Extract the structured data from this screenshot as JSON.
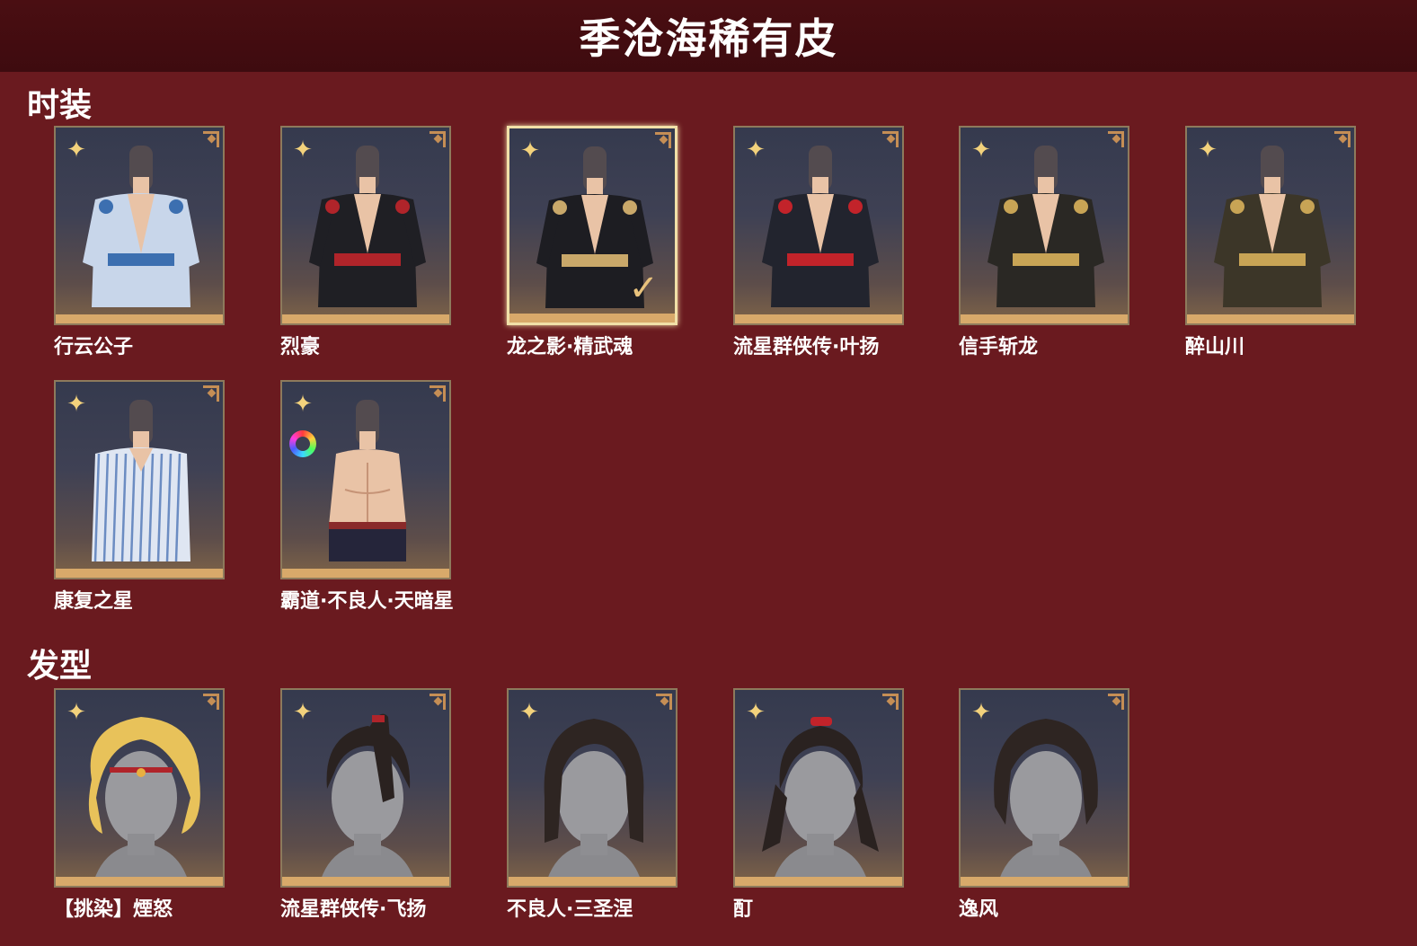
{
  "title": "季沧海稀有皮",
  "sections": [
    {
      "title": "时装",
      "items": [
        {
          "name": "行云公子",
          "selected": false,
          "outfit": "white-blue-robe"
        },
        {
          "name": "烈豪",
          "selected": false,
          "outfit": "black-red-armor"
        },
        {
          "name": "龙之影·精武魂",
          "selected": true,
          "outfit": "black-jacket"
        },
        {
          "name": "流星群侠传·叶扬",
          "selected": false,
          "outfit": "dark-armor-red-scarf"
        },
        {
          "name": "信手斩龙",
          "selected": false,
          "outfit": "dark-dragon-armor"
        },
        {
          "name": "醉山川",
          "selected": false,
          "outfit": "gold-armor"
        },
        {
          "name": "康复之星",
          "selected": false,
          "outfit": "striped-pajamas"
        },
        {
          "name": "霸道·不良人·天暗星",
          "selected": false,
          "outfit": "shirtless",
          "dye_icon": "color-palette-icon"
        }
      ]
    },
    {
      "title": "发型",
      "items": [
        {
          "name": "【挑染】煙怒",
          "hair": "blonde-spiky"
        },
        {
          "name": "流星群侠传·飞扬",
          "hair": "dark-topknot"
        },
        {
          "name": "不良人·三圣涅",
          "hair": "dark-long"
        },
        {
          "name": "酊",
          "hair": "dark-ponytail-red-tie"
        },
        {
          "name": "逸风",
          "hair": "dark-shaggy"
        }
      ]
    }
  ],
  "colors": {
    "background": "#6a1a1f",
    "header": "#3e0b0f",
    "tile_border": "#8d7a5c",
    "tile_bottom_bar": "#d8a96a",
    "star": "#f3d27c",
    "selected_border": "#f1e0a8"
  }
}
